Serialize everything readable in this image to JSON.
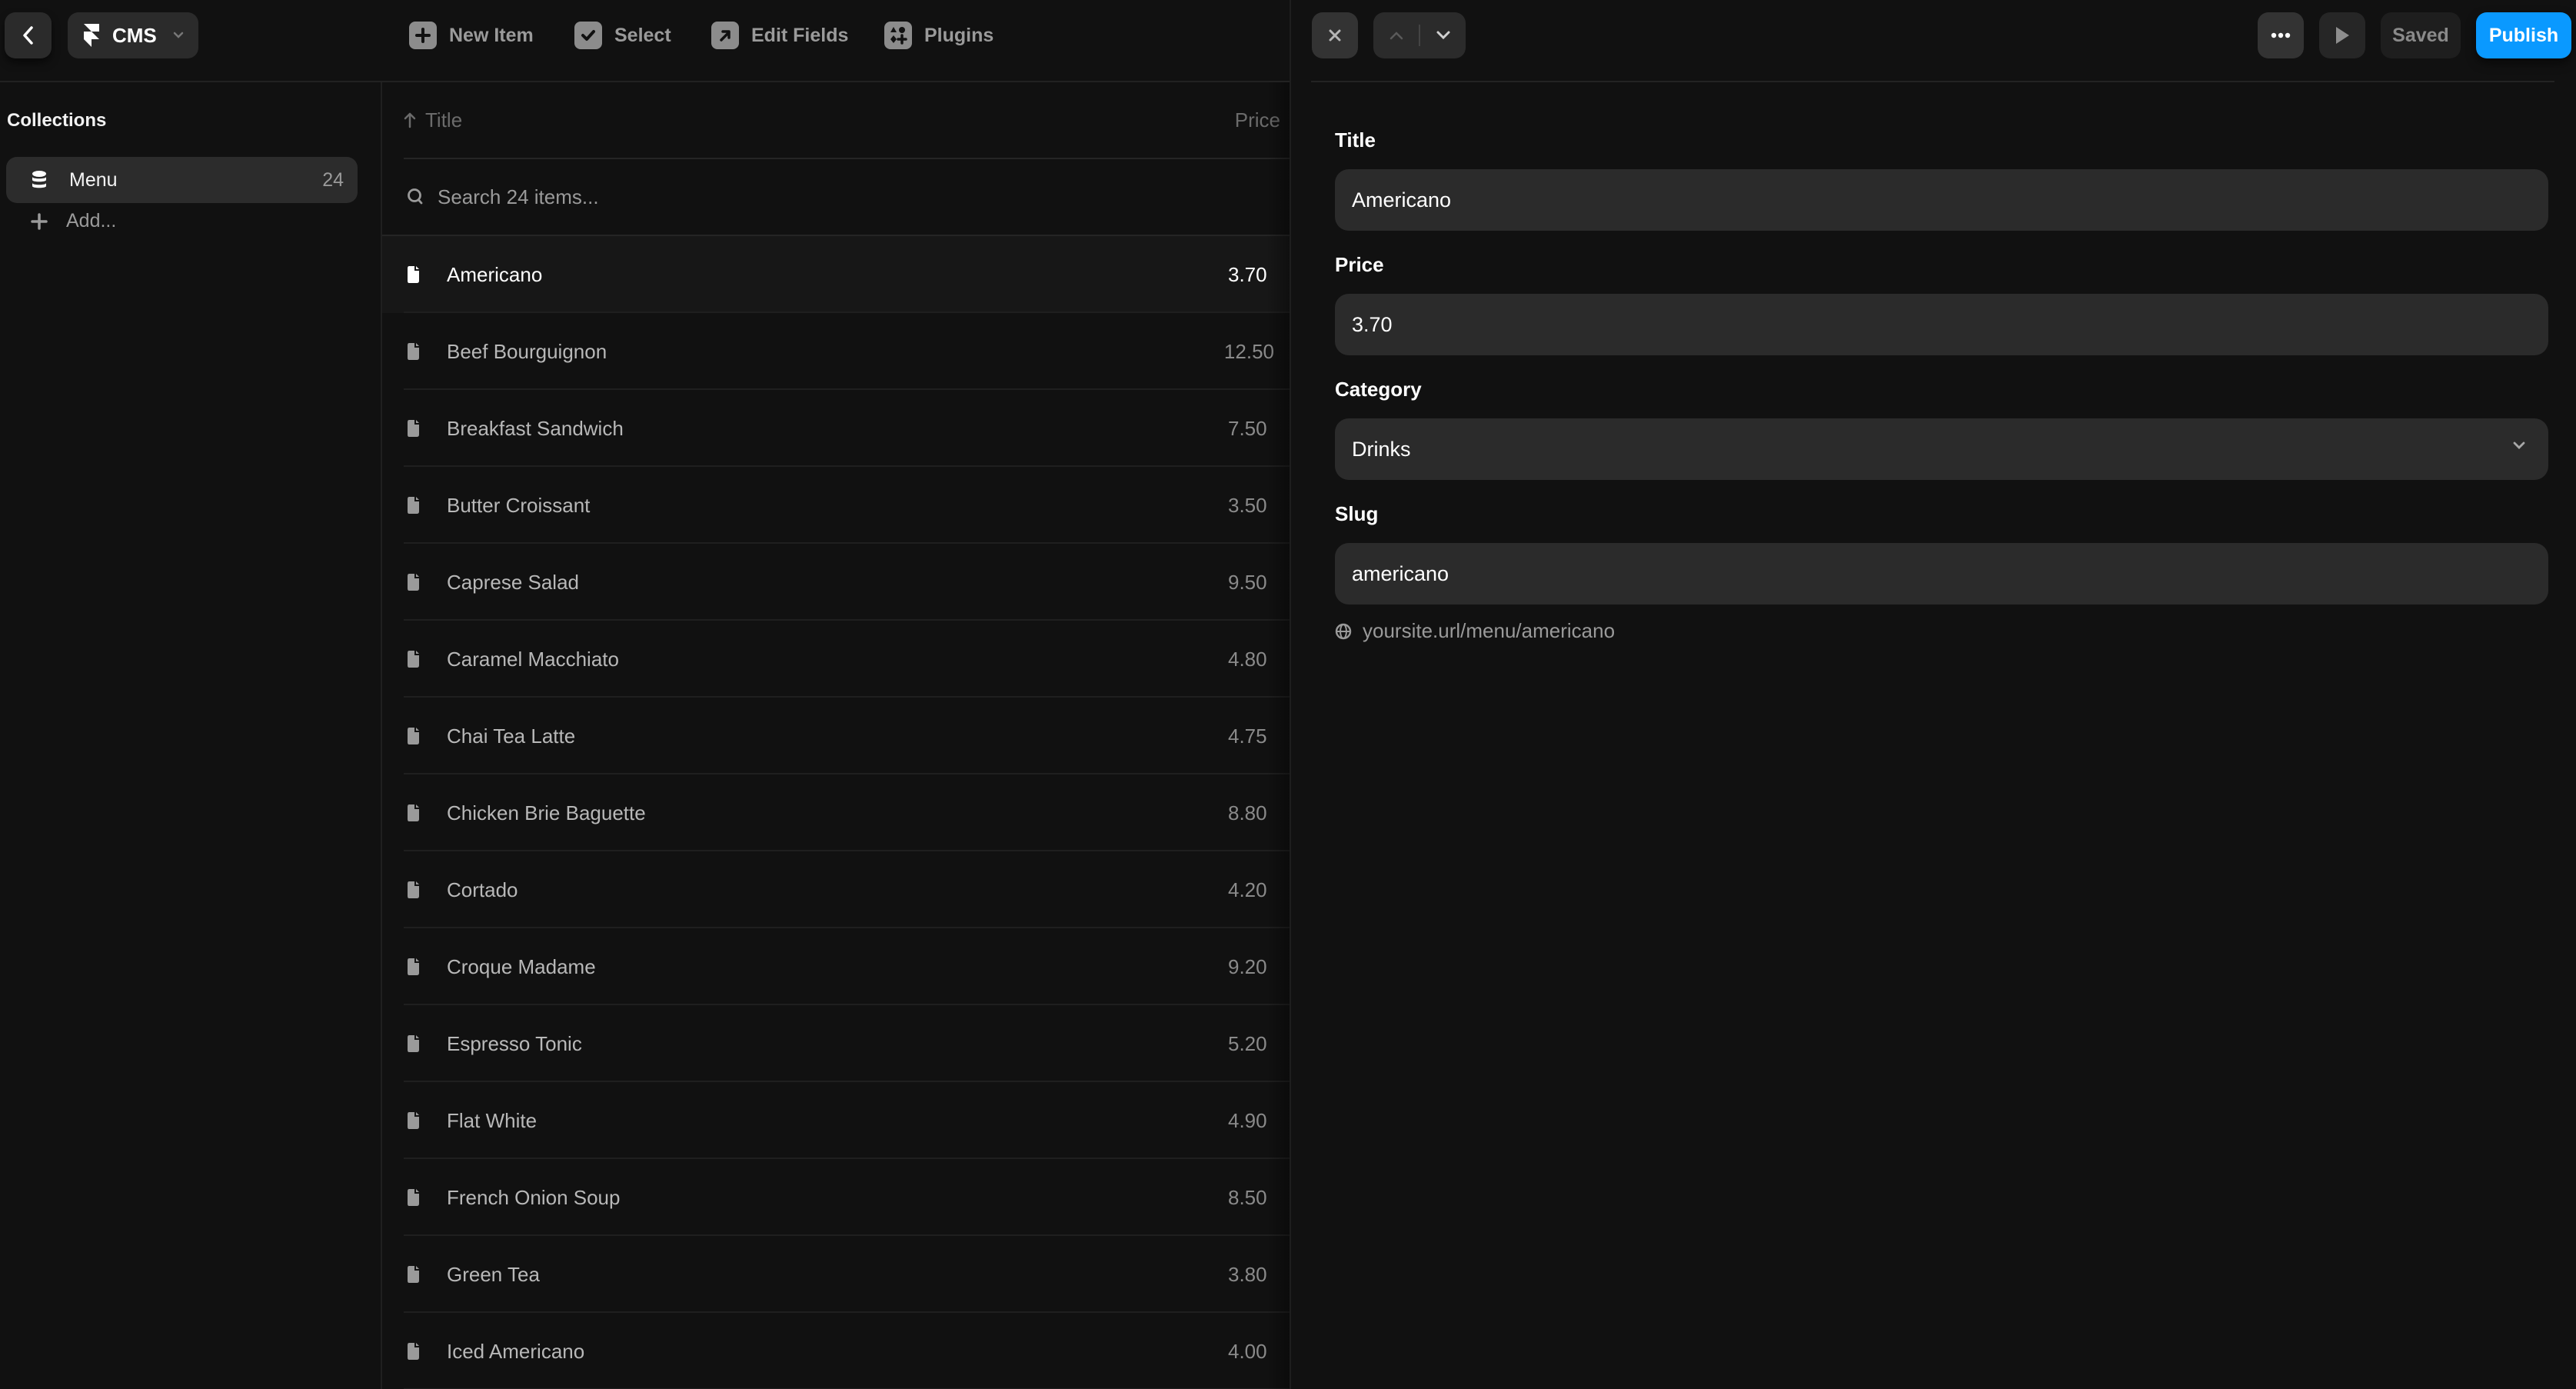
{
  "app": {
    "module_label": "CMS",
    "icons": {
      "back": "chevron-left-icon",
      "logo": "framer-logo-icon",
      "module_dropdown": "chevron-down-icon"
    }
  },
  "toolbar": {
    "items": [
      {
        "label": "New Item",
        "icon": "plus-icon"
      },
      {
        "label": "Select",
        "icon": "checkmark-icon"
      },
      {
        "label": "Edit Fields",
        "icon": "arrow-up-right-icon"
      },
      {
        "label": "Plugins",
        "icon": "plugins-icon"
      }
    ]
  },
  "sidebar": {
    "title": "Collections",
    "collections": [
      {
        "label": "Menu",
        "count": "24",
        "icon": "database-icon",
        "selected": true
      }
    ],
    "add_label": "Add..."
  },
  "list": {
    "columns": {
      "title": "Title",
      "price": "Price",
      "sort_icon": "arrow-up-icon"
    },
    "search_placeholder": "Search 24 items...",
    "rows": [
      {
        "title": "Americano",
        "price": "3.70",
        "selected": true
      },
      {
        "title": "Beef Bourguignon",
        "price": "12.50"
      },
      {
        "title": "Breakfast Sandwich",
        "price": "7.50"
      },
      {
        "title": "Butter Croissant",
        "price": "3.50"
      },
      {
        "title": "Caprese Salad",
        "price": "9.50"
      },
      {
        "title": "Caramel Macchiato",
        "price": "4.80"
      },
      {
        "title": "Chai Tea Latte",
        "price": "4.75"
      },
      {
        "title": "Chicken Brie Baguette",
        "price": "8.80"
      },
      {
        "title": "Cortado",
        "price": "4.20"
      },
      {
        "title": "Croque Madame",
        "price": "9.20"
      },
      {
        "title": "Espresso Tonic",
        "price": "5.20"
      },
      {
        "title": "Flat White",
        "price": "4.90"
      },
      {
        "title": "French Onion Soup",
        "price": "8.50"
      },
      {
        "title": "Green Tea",
        "price": "3.80"
      },
      {
        "title": "Iced Americano",
        "price": "4.00"
      }
    ]
  },
  "editor": {
    "header": {
      "close_icon": "close-icon",
      "prev_icon": "chevron-up-icon",
      "next_icon": "chevron-down-icon",
      "more_icon": "more-horizontal-icon",
      "preview_icon": "play-icon",
      "saved_label": "Saved",
      "publish_label": "Publish",
      "publish_color": "#0a99ff"
    },
    "fields": {
      "title": {
        "label": "Title",
        "value": "Americano"
      },
      "price": {
        "label": "Price",
        "value": "3.70"
      },
      "category": {
        "label": "Category",
        "value": "Drinks"
      },
      "slug": {
        "label": "Slug",
        "value": "americano",
        "url": "yoursite.url/menu/americano"
      }
    }
  }
}
